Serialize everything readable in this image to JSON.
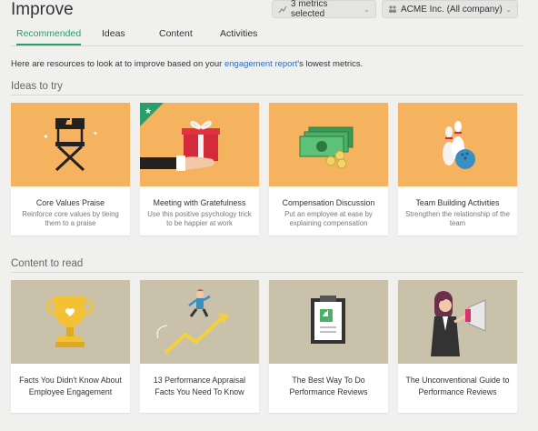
{
  "header": {
    "title": "Improve",
    "metrics_dropdown": "3 metrics selected",
    "company_dropdown": "ACME Inc. (All company)"
  },
  "tabs": [
    {
      "label": "Recommended",
      "active": true
    },
    {
      "label": "Ideas",
      "active": false
    },
    {
      "label": "Content",
      "active": false
    },
    {
      "label": "Activities",
      "active": false
    }
  ],
  "intro": {
    "before": "Here are resources to look at to improve based on your ",
    "link": "engagement report",
    "after": "'s lowest metrics."
  },
  "ideas": {
    "heading": "Ideas to try",
    "cards": [
      {
        "title": "Core Values Praise",
        "desc": "Reinforce core values by tieing them to a praise",
        "icon": "director-chair-icon"
      },
      {
        "title": "Meeting with Gratefulness",
        "desc": "Use this positive psychology trick to be happier at work",
        "icon": "gift-icon"
      },
      {
        "title": "Compensation Discussion",
        "desc": "Put an employee at ease by explaining compensation",
        "icon": "money-icon"
      },
      {
        "title": "Team Building Activities",
        "desc": "Strengthen the relationship of the team",
        "icon": "bowling-icon"
      }
    ]
  },
  "content": {
    "heading": "Content to read",
    "cards": [
      {
        "title": "Facts You Didn't Know About Employee Engagement",
        "icon": "trophy-icon"
      },
      {
        "title": "13 Performance Appraisal Facts You Need To Know",
        "icon": "growth-arrow-icon"
      },
      {
        "title": "The Best Way To Do Performance Reviews",
        "icon": "clipboard-icon"
      },
      {
        "title": "The Unconventional Guide to Performance Reviews",
        "icon": "megaphone-icon"
      }
    ]
  },
  "colors": {
    "accent": "#2a9d6b",
    "link": "#2c6fb3",
    "card_orange": "#f5b35f",
    "card_khaki": "#c9c1a9"
  }
}
